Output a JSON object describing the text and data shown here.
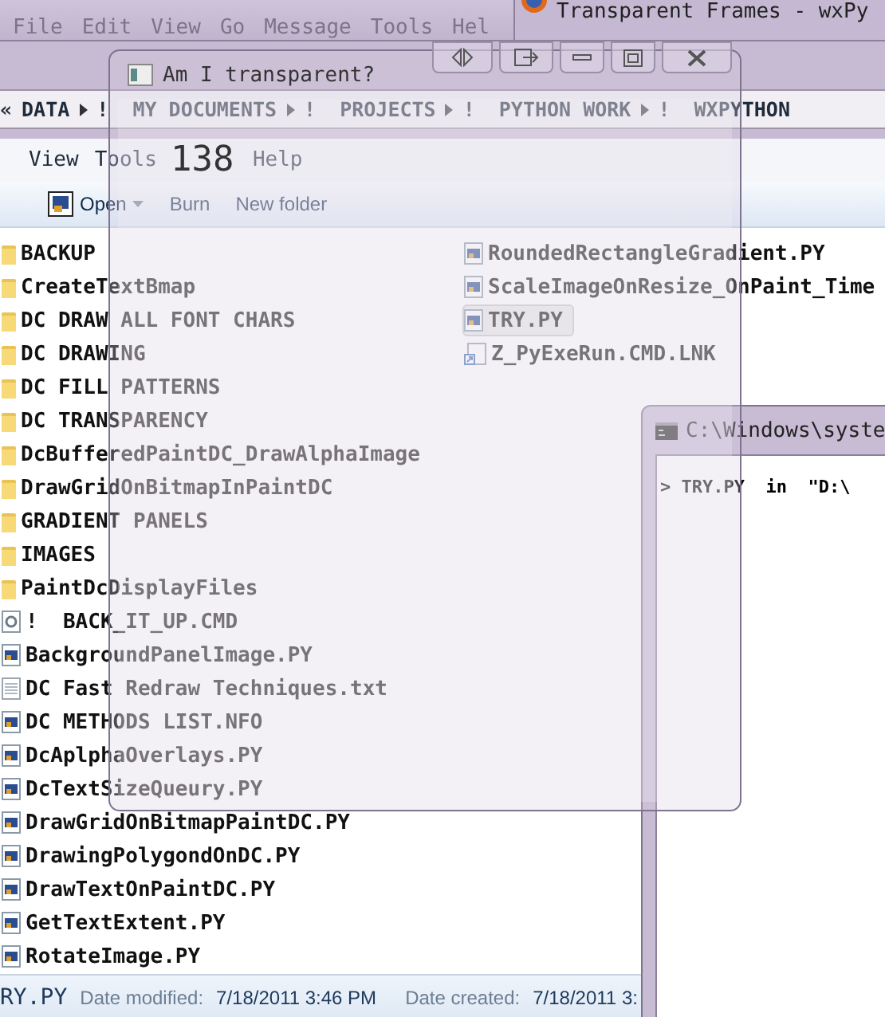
{
  "mail_window": {
    "menu": [
      "File",
      "Edit",
      "View",
      "Go",
      "Message",
      "Tools",
      "Hel"
    ]
  },
  "browser_window": {
    "title": "Transparent Frames - wxPy"
  },
  "explorer": {
    "back_symbol": "«",
    "breadcrumb": [
      "DATA",
      "!  MY DOCUMENTS",
      "!  PROJECTS",
      "!  PYTHON WORK",
      "!  WXPYTHON"
    ],
    "menu": [
      "View",
      "Tools",
      "Help"
    ],
    "toolbar": [
      {
        "label": "Open",
        "kind": "open"
      },
      {
        "label": "Burn",
        "kind": "plain"
      },
      {
        "label": "New folder",
        "kind": "plain"
      }
    ],
    "files": [
      {
        "name": "BACKUP",
        "kind": "folder",
        "selected": false
      },
      {
        "name": "CreateTextBmap",
        "kind": "folder",
        "selected": false
      },
      {
        "name": "DC DRAW ALL FONT CHARS",
        "kind": "folder",
        "selected": false
      },
      {
        "name": "DC DRAWING",
        "kind": "folder",
        "selected": false
      },
      {
        "name": "DC FILL PATTERNS",
        "kind": "folder",
        "selected": false
      },
      {
        "name": "DC TRANSPARENCY",
        "kind": "folder",
        "selected": false
      },
      {
        "name": "DcBufferedPaintDC_DrawAlphaImage",
        "kind": "folder",
        "selected": false
      },
      {
        "name": "DrawGridOnBitmapInPaintDC",
        "kind": "folder",
        "selected": false
      },
      {
        "name": "GRADIENT PANELS",
        "kind": "folder",
        "selected": false
      },
      {
        "name": "IMAGES",
        "kind": "folder",
        "selected": false
      },
      {
        "name": "PaintDcDisplayFiles",
        "kind": "folder",
        "selected": false
      },
      {
        "name": "!  BACK_IT_UP.CMD",
        "kind": "batch",
        "selected": false
      },
      {
        "name": "BackgroundPanelImage.PY",
        "kind": "script",
        "selected": false
      },
      {
        "name": "DC Fast Redraw Techniques.txt",
        "kind": "text",
        "selected": false
      },
      {
        "name": "DC METHODS LIST.NFO",
        "kind": "script",
        "selected": false
      },
      {
        "name": "DcAplphaOverlays.PY",
        "kind": "script",
        "selected": false
      },
      {
        "name": "DcTextSizeQueury.PY",
        "kind": "script",
        "selected": false
      },
      {
        "name": "DrawGridOnBitmapPaintDC.PY",
        "kind": "script",
        "selected": false
      },
      {
        "name": "DrawingPolygondOnDC.PY",
        "kind": "script",
        "selected": false
      },
      {
        "name": "DrawTextOnPaintDC.PY",
        "kind": "script",
        "selected": false
      },
      {
        "name": "GetTextExtent.PY",
        "kind": "script",
        "selected": false
      },
      {
        "name": "RotateImage.PY",
        "kind": "script",
        "selected": false
      },
      {
        "name": "RoundedRectangleGradient.PY",
        "kind": "script",
        "selected": false
      },
      {
        "name": "ScaleImageOnResize_OnPaint_Time",
        "kind": "script",
        "selected": false
      },
      {
        "name": "TRY.PY",
        "kind": "script",
        "selected": true
      },
      {
        "name": "Z_PyExeRun.CMD.LNK",
        "kind": "shortcut",
        "selected": false
      }
    ],
    "status": {
      "name": "RY.PY",
      "modified_label": "Date modified:",
      "modified": "7/18/2011 3:46 PM",
      "created_label": "Date created:",
      "created": "7/18/2011 3:"
    }
  },
  "console": {
    "title": "C:\\Windows\\syste",
    "line": "> TRY.PY  in  \"D:\\"
  },
  "overlay": {
    "title": "Am I transparent?",
    "counter": "138"
  }
}
